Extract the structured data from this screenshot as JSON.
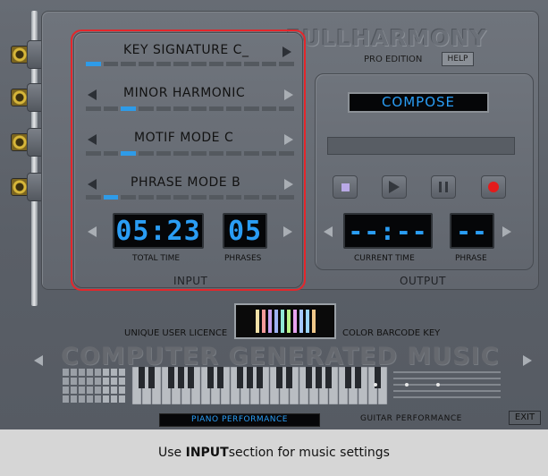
{
  "brand": {
    "title": "FULLHARMONY",
    "edition": "PRO EDITION",
    "help_label": "HELP"
  },
  "input": {
    "section_label": "INPUT",
    "rows": [
      {
        "label": "KEY SIGNATURE  C_",
        "level_segment": 0
      },
      {
        "label": "MINOR HARMONIC",
        "level_segment": 2
      },
      {
        "label": "MOTIF  MODE  C",
        "level_segment": 2
      },
      {
        "label": "PHRASE  MODE  B",
        "level_segment": 1
      }
    ],
    "total_time": {
      "value": "05:23",
      "label": "TOTAL TIME"
    },
    "phrases": {
      "value": "05",
      "label": "PHRASES"
    }
  },
  "output": {
    "section_label": "OUTPUT",
    "compose_label": "COMPOSE",
    "current_time": {
      "value": "--:--",
      "label": "CURRENT TIME"
    },
    "phrase": {
      "value": "--",
      "label": "PHRASE"
    }
  },
  "licence": {
    "left_label": "UNIQUE USER LICENCE",
    "right_label": "COLOR BARCODE KEY",
    "barcode_colors": [
      "#f2e1a8",
      "#f59a9a",
      "#c7a0f0",
      "#9fb2f5",
      "#8fe8d6",
      "#b8f28a",
      "#e7a3f0",
      "#a6c8ff",
      "#9ad4ff",
      "#f0c88a"
    ]
  },
  "footer": {
    "background_text": "COMPUTER GENERATED MUSIC",
    "piano_label": "PIANO PERFORMANCE",
    "guitar_label": "GUITAR PERFORMANCE",
    "exit_label": "EXIT"
  },
  "caption": {
    "prefix": "Use ",
    "emphasis": "INPUT",
    "suffix": " section for music settings"
  },
  "colors": {
    "accent_blue": "#2a9df4",
    "highlight_red": "#e4262b",
    "record_red": "#e41b1b"
  }
}
